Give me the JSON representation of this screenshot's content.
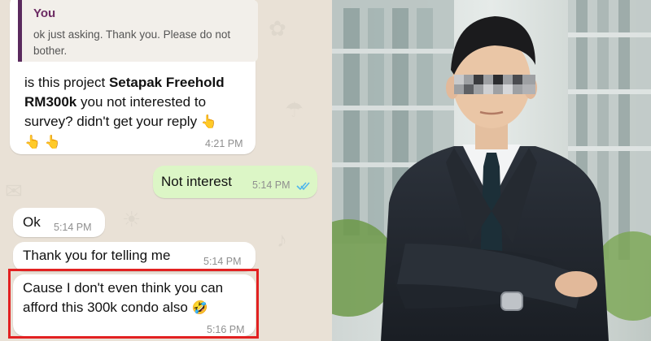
{
  "chat": {
    "quoted": {
      "sender": "You",
      "text": "ok just asking. Thank you. Please do not bother."
    },
    "messages": [
      {
        "id": "m1",
        "direction": "incoming",
        "text_prefix": "is this project ",
        "text_bold": "Setapak Freehold RM300k",
        "text_suffix": " you not interested to survey? didn't get your reply",
        "time": "4:21 PM"
      },
      {
        "id": "m2",
        "direction": "outgoing",
        "text": "Not interest",
        "time": "5:14 PM",
        "read": true
      },
      {
        "id": "m3",
        "direction": "incoming",
        "text": "Ok",
        "time": "5:14 PM"
      },
      {
        "id": "m4",
        "direction": "incoming",
        "text": "Thank you for telling me",
        "time": "5:14 PM"
      },
      {
        "id": "m5",
        "direction": "incoming",
        "text": "Cause I don't even think you can afford this 300k condo also",
        "time": "5:16 PM",
        "highlighted": true
      }
    ]
  },
  "icons": {
    "read_receipt": "double-check-icon",
    "hand_emoji": "pointing-hand-emoji",
    "laughing_emoji": "rofl-emoji"
  },
  "colors": {
    "chat_bg": "#e9e1d6",
    "incoming_bubble": "#ffffff",
    "outgoing_bubble": "#dcf6c6",
    "quote_accent": "#5a2a5e",
    "highlight_border": "#e22121",
    "read_tick": "#4fb6ec"
  }
}
